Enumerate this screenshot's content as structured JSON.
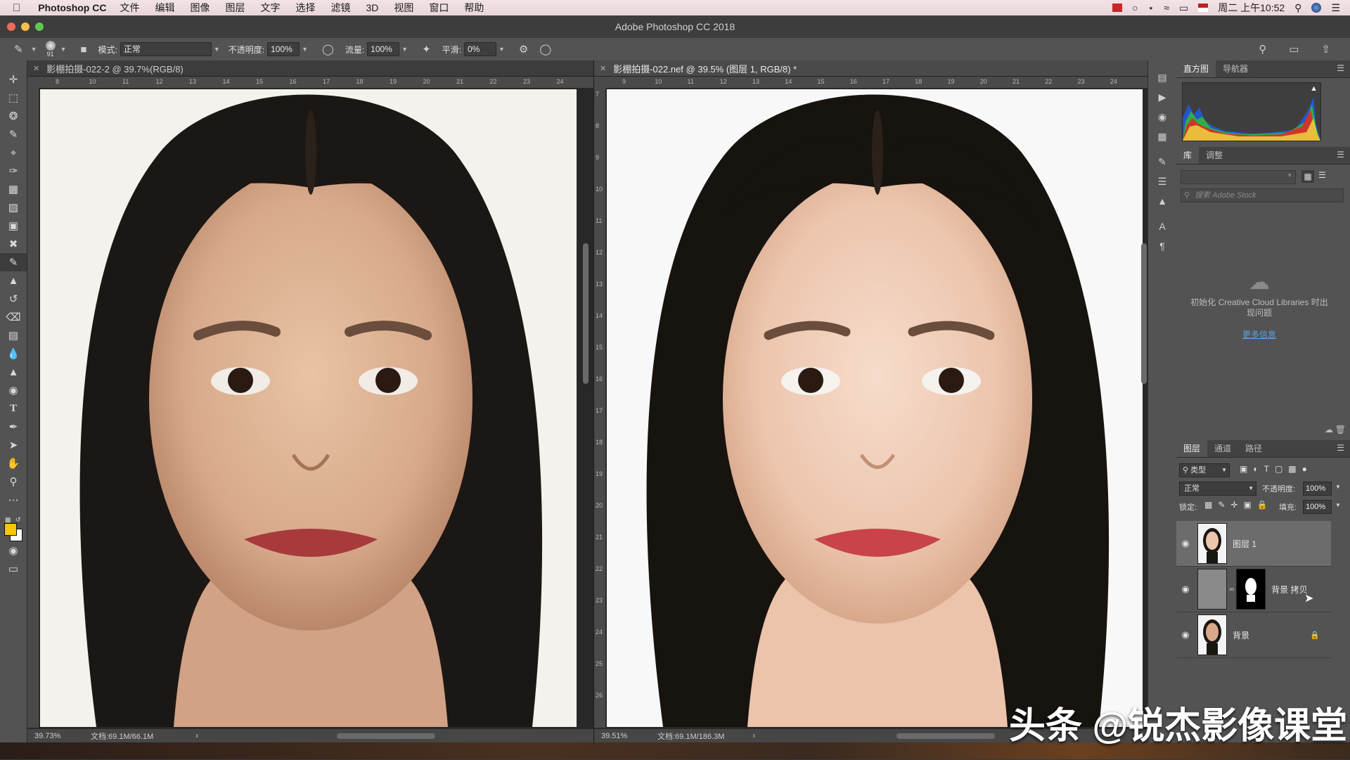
{
  "menubar": {
    "apple": "",
    "app_name": "Photoshop CC",
    "items": [
      "文件",
      "编辑",
      "图像",
      "图层",
      "文字",
      "选择",
      "滤镜",
      "3D",
      "视图",
      "窗口",
      "帮助"
    ],
    "clock": "周二 上午10:52"
  },
  "window": {
    "title": "Adobe Photoshop CC 2018"
  },
  "options": {
    "brush_size": "91",
    "mode_label": "模式:",
    "mode_value": "正常",
    "opacity_label": "不透明度:",
    "opacity_value": "100%",
    "flow_label": "流量:",
    "flow_value": "100%",
    "smooth_label": "平滑:",
    "smooth_value": "0%"
  },
  "documents": [
    {
      "tab": "影棚拍摄-022-2 @ 39.7%(RGB/8)",
      "zoom": "39.73%",
      "doc_info": "文档:69.1M/66.1M",
      "ruler_h": [
        "8",
        "10",
        "11",
        "12",
        "13",
        "14",
        "15",
        "16",
        "17",
        "18",
        "19",
        "20",
        "21",
        "22",
        "23",
        "24"
      ]
    },
    {
      "tab": "影棚拍摄-022.nef @ 39.5% (图层 1, RGB/8) *",
      "zoom": "39.51%",
      "doc_info": "文档:69.1M/186.3M",
      "ruler_h": [
        "9",
        "10",
        "11",
        "12",
        "13",
        "14",
        "15",
        "16",
        "17",
        "18",
        "19",
        "20",
        "21",
        "22",
        "23",
        "24"
      ],
      "ruler_v": [
        "7",
        "8",
        "9",
        "10",
        "11",
        "12",
        "13",
        "14",
        "15",
        "16",
        "17",
        "18",
        "19",
        "20",
        "21",
        "22",
        "23",
        "24",
        "25",
        "26"
      ]
    }
  ],
  "panels": {
    "top_tabs": [
      "直方图",
      "导航器"
    ],
    "lib_tabs": [
      "库",
      "调整"
    ],
    "search_placeholder": "搜索 Adobe Stock",
    "cc_message": "初始化 Creative Cloud Libraries 时出现问题",
    "more_info": "更多信息",
    "layer_tabs": [
      "图层",
      "通道",
      "路径"
    ],
    "kind_filter": "类型",
    "blend_mode": "正常",
    "opacity_label": "不透明度:",
    "opacity_value": "100%",
    "lock_label": "锁定:",
    "fill_label": "填充:",
    "fill_value": "100%",
    "layers": [
      {
        "name": "图层 1"
      },
      {
        "name": "背景 拷贝"
      },
      {
        "name": "背景"
      }
    ]
  },
  "watermark": "头条 @锐杰影像课堂",
  "colors": {
    "foreground": "#f5c800",
    "background": "#ffffff",
    "accent": "#5aa0e8"
  }
}
